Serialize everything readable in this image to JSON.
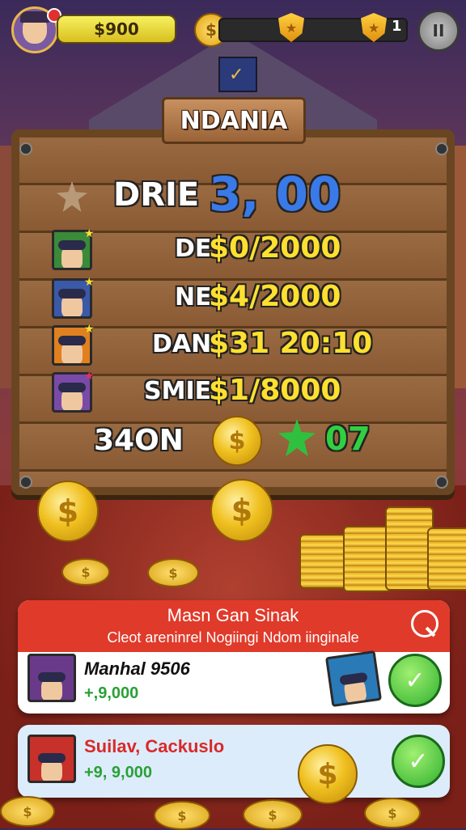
{
  "hud": {
    "cash": "$900",
    "level": "1"
  },
  "board": {
    "title": "NDANIA",
    "header_label": "DRIE",
    "header_value": "3, 00",
    "rows": [
      {
        "label": "DE",
        "value": "$0/2000",
        "color": "#3a8a3a",
        "star": "#ffe030"
      },
      {
        "label": "NE",
        "value": "$4/2000",
        "color": "#3a5aa8",
        "star": "#ffe030"
      },
      {
        "label": "DAN",
        "value": "$31 20:10",
        "color": "#e08020",
        "star": "#ffe030"
      },
      {
        "label": "SMIE:",
        "value": "$1/8000",
        "color": "#7a4aa8",
        "star": "#e03060"
      }
    ],
    "footer_label": "34ON",
    "footer_count": "07"
  },
  "notification": {
    "title": "Masn Gan Sinak",
    "subtitle": "Cleot areninrel Nogiingi Ndom iinginale"
  },
  "players": [
    {
      "name": "Manhal 9506",
      "amount": "+,9,000"
    },
    {
      "name": "Suilav, Cackuslo",
      "amount": "+9, 9,000"
    }
  ]
}
